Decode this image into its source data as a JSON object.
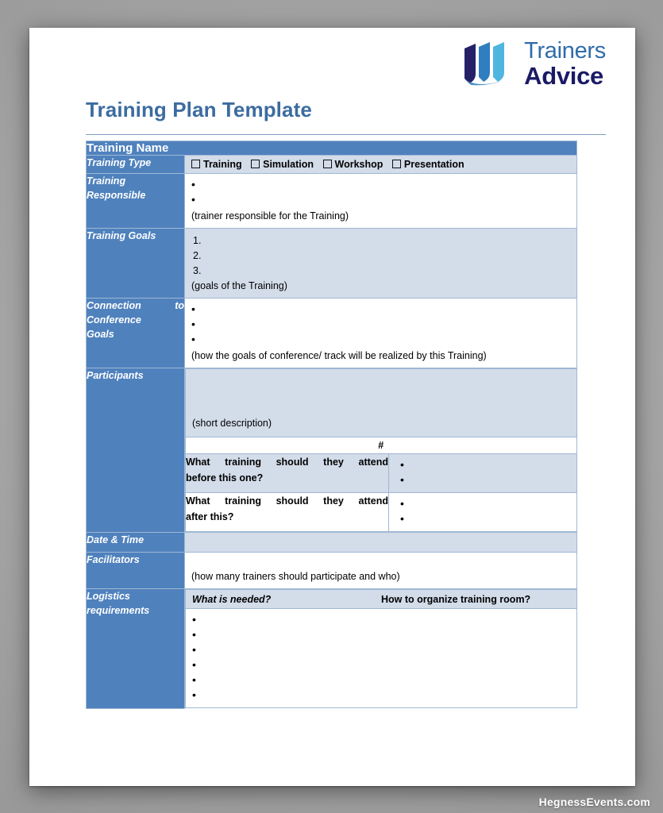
{
  "brand": {
    "logo_line1": "Trainers",
    "logo_line2": "Advice",
    "logo_icon": "stacked-pages-mark",
    "color_dark": "#242169",
    "color_mid": "#2f7ec0",
    "color_light": "#4fb6e0"
  },
  "document": {
    "title": "Training Plan Template"
  },
  "table": {
    "header_band": "Training Name",
    "rows": {
      "training_type": {
        "label": "Training Type",
        "options": [
          "Training",
          "Simulation",
          "Workshop",
          "Presentation"
        ]
      },
      "training_responsible": {
        "label": "Training Responsible",
        "bullets": [
          "",
          ""
        ],
        "hint": "(trainer responsible for the Training)"
      },
      "training_goals": {
        "label": "Training Goals",
        "items": [
          "",
          "",
          ""
        ],
        "hint": "(goals of the Training)"
      },
      "connection_goals": {
        "label_part1": "Connection",
        "label_part2": "to",
        "label_line2": "Conference",
        "label_line3": "Goals",
        "bullets": [
          "",
          "",
          ""
        ],
        "hint": "(how the goals of conference/ track will be realized by this Training)"
      },
      "participants": {
        "label": "Participants",
        "hint": "(short description)",
        "count_symbol": "#",
        "before_question": "What training should they attend before this one?",
        "before_question_l1": "What training should they attend",
        "before_question_l2": "before this one?",
        "before_bullets": [
          "",
          ""
        ],
        "after_question_l1": "What training should they attend",
        "after_question_l2": "after this?",
        "after_bullets": [
          "",
          ""
        ]
      },
      "date_time": {
        "label": "Date & Time",
        "value": ""
      },
      "facilitators": {
        "label": "Facilitators",
        "hint": "(how many trainers should participate and who)"
      },
      "logistics": {
        "label_line1": "Logistics",
        "label_line2": "requirements",
        "col_a": "What is needed?",
        "col_b": "How to organize training room?",
        "bullets": [
          "",
          "",
          "",
          "",
          "",
          ""
        ]
      }
    }
  },
  "watermark": {
    "text": "HegnessEvents.com"
  }
}
